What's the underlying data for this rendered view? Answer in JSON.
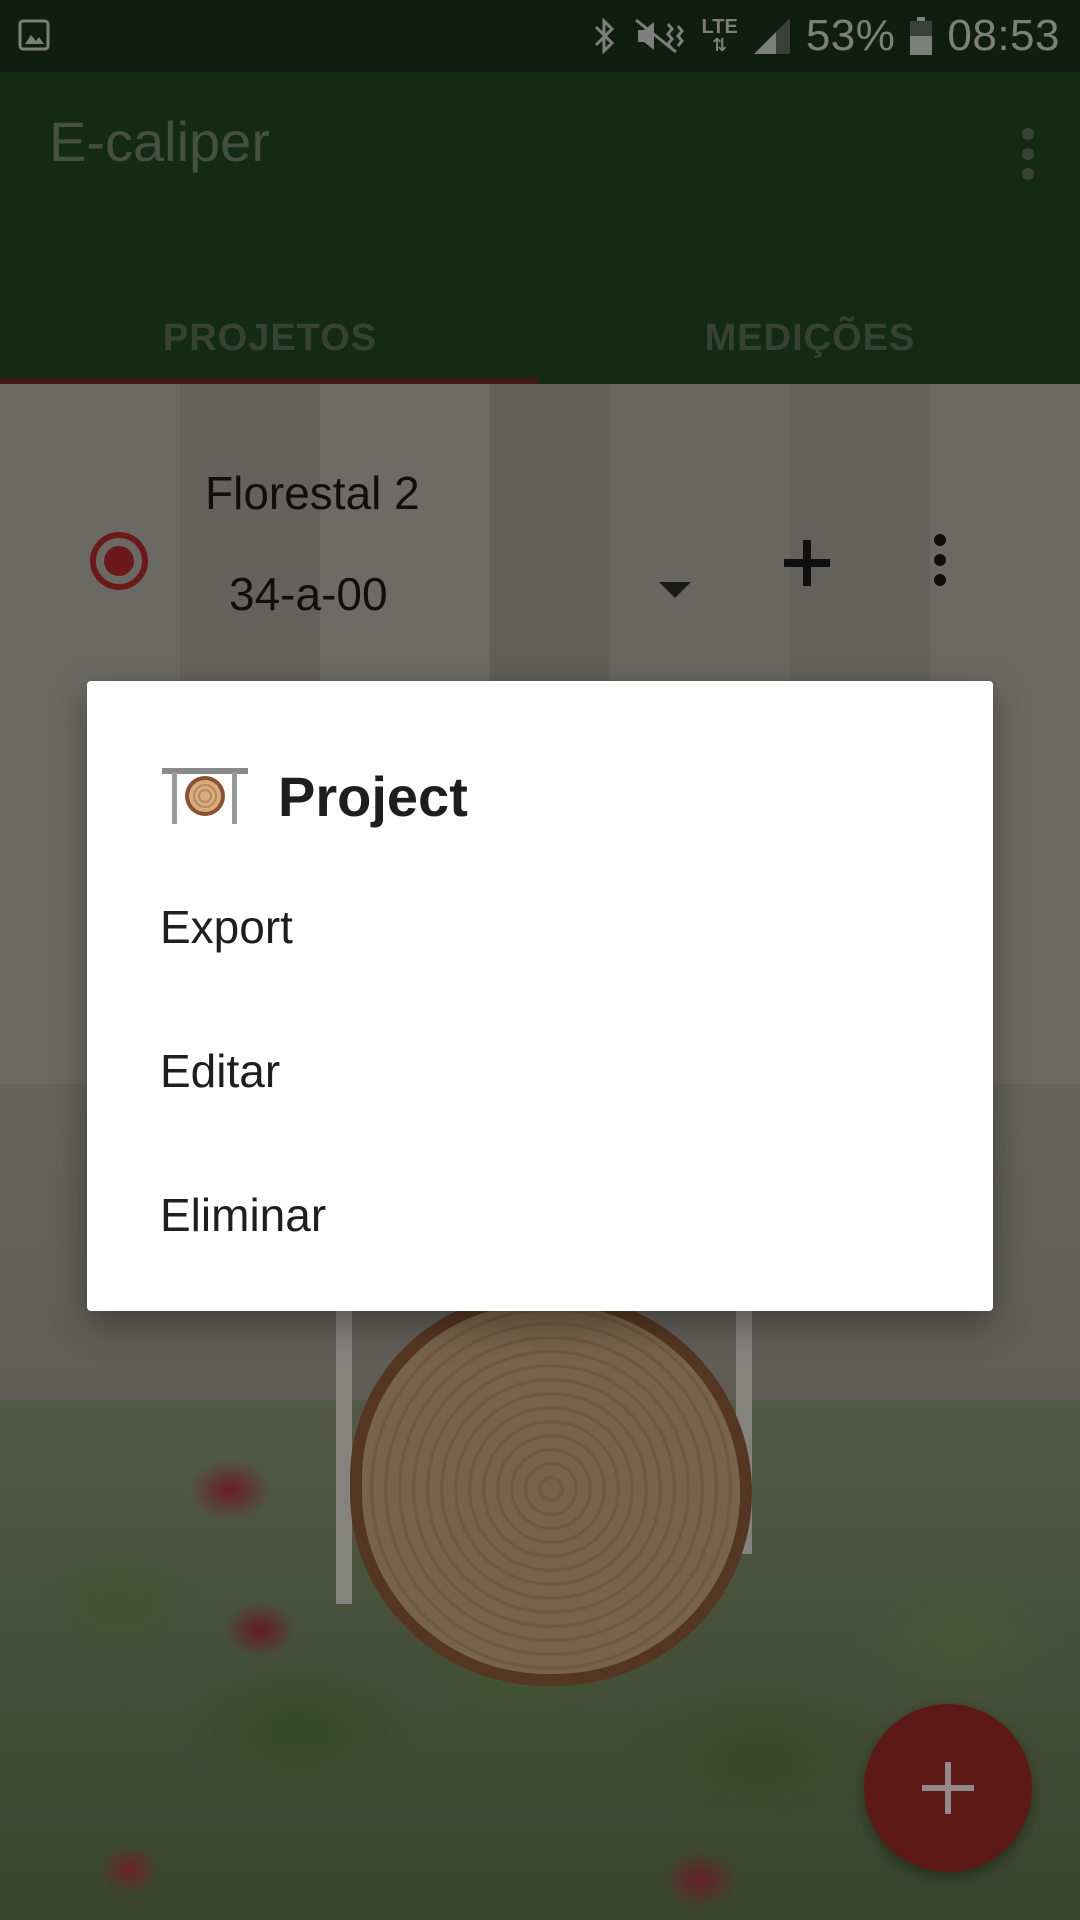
{
  "status_bar": {
    "battery": "53%",
    "time": "08:53",
    "network": "LTE"
  },
  "app_bar": {
    "title": "E-caliper",
    "tabs": [
      {
        "label": "PROJETOS",
        "selected": true
      },
      {
        "label": "MEDIÇÕES",
        "selected": false
      }
    ]
  },
  "project_row": {
    "name": "Florestal 2",
    "plot": "34-a-00"
  },
  "dialog": {
    "title": "Project",
    "items": [
      {
        "label": "Export"
      },
      {
        "label": "Editar"
      },
      {
        "label": "Eliminar"
      }
    ]
  },
  "colors": {
    "status_bar": "#1b331b",
    "app_bar": "#204820",
    "accent": "#9b2a26",
    "tab_indicator": "#6a2a24"
  },
  "icons": {
    "status_left": "image-icon",
    "bluetooth": "bluetooth-icon",
    "mute": "vibrate-mute-icon",
    "signal": "signal-icon",
    "battery": "battery-icon",
    "overflow": "more-vert-icon",
    "radio": "radio-selected-icon",
    "add": "plus-icon",
    "fab": "plus-icon",
    "dialog_logo": "caliper-log-icon"
  }
}
